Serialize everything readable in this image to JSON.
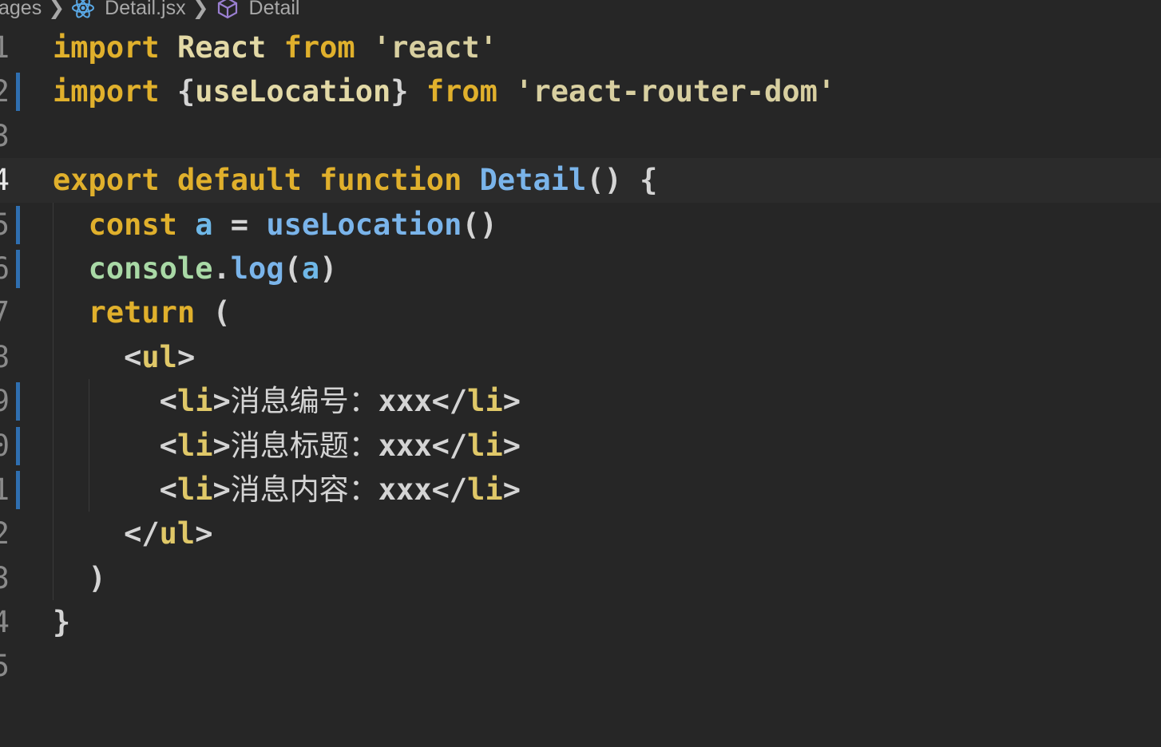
{
  "breadcrumb": {
    "items": [
      "ages",
      "Detail.jsx",
      "Detail"
    ],
    "icons": [
      "react-icon",
      "component-icon"
    ],
    "colors": {
      "react_icon": "#5aa9e6",
      "component_icon": "#9a7fd1"
    }
  },
  "editor": {
    "current_line": "4",
    "lines": [
      {
        "num": "1",
        "tokens": [
          {
            "t": "import",
            "c": "kw"
          },
          {
            "t": " ",
            "c": "pn"
          },
          {
            "t": "React",
            "c": "id"
          },
          {
            "t": " ",
            "c": "pn"
          },
          {
            "t": "from",
            "c": "kw"
          },
          {
            "t": " ",
            "c": "pn"
          },
          {
            "t": "'react'",
            "c": "str"
          }
        ]
      },
      {
        "num": "2",
        "tokens": [
          {
            "t": "import",
            "c": "kw"
          },
          {
            "t": " {",
            "c": "pn"
          },
          {
            "t": "useLocation",
            "c": "id"
          },
          {
            "t": "} ",
            "c": "pn"
          },
          {
            "t": "from",
            "c": "kw"
          },
          {
            "t": " ",
            "c": "pn"
          },
          {
            "t": "'react-router-dom'",
            "c": "str"
          }
        ]
      },
      {
        "num": "3",
        "tokens": []
      },
      {
        "num": "4",
        "tokens": [
          {
            "t": "export",
            "c": "kw"
          },
          {
            "t": " ",
            "c": "pn"
          },
          {
            "t": "default",
            "c": "kw"
          },
          {
            "t": " ",
            "c": "pn"
          },
          {
            "t": "function",
            "c": "kw"
          },
          {
            "t": " ",
            "c": "pn"
          },
          {
            "t": "Detail",
            "c": "fn"
          },
          {
            "t": "() {",
            "c": "pn"
          }
        ]
      },
      {
        "num": "5",
        "tokens": [
          {
            "t": "  ",
            "c": "pn"
          },
          {
            "t": "const",
            "c": "kw"
          },
          {
            "t": " ",
            "c": "pn"
          },
          {
            "t": "a",
            "c": "var"
          },
          {
            "t": " = ",
            "c": "pn"
          },
          {
            "t": "useLocation",
            "c": "fn"
          },
          {
            "t": "()",
            "c": "pn"
          }
        ]
      },
      {
        "num": "6",
        "tokens": [
          {
            "t": "  ",
            "c": "pn"
          },
          {
            "t": "console",
            "c": "obj"
          },
          {
            "t": ".",
            "c": "pn"
          },
          {
            "t": "log",
            "c": "fn"
          },
          {
            "t": "(",
            "c": "pn"
          },
          {
            "t": "a",
            "c": "var"
          },
          {
            "t": ")",
            "c": "pn"
          }
        ]
      },
      {
        "num": "7",
        "tokens": [
          {
            "t": "  ",
            "c": "pn"
          },
          {
            "t": "return",
            "c": "kw"
          },
          {
            "t": " (",
            "c": "pn"
          }
        ]
      },
      {
        "num": "8",
        "tokens": [
          {
            "t": "    <",
            "c": "tag"
          },
          {
            "t": "ul",
            "c": "tagn"
          },
          {
            "t": ">",
            "c": "tag"
          }
        ]
      },
      {
        "num": "9",
        "tokens": [
          {
            "t": "      <",
            "c": "tag"
          },
          {
            "t": "li",
            "c": "tagn"
          },
          {
            "t": ">",
            "c": "tag"
          },
          {
            "t": "消息编号：",
            "c": "cjk"
          },
          {
            "t": "xxx</",
            "c": "tag"
          },
          {
            "t": "li",
            "c": "tagn"
          },
          {
            "t": ">",
            "c": "tag"
          }
        ]
      },
      {
        "num": "0",
        "tokens": [
          {
            "t": "      <",
            "c": "tag"
          },
          {
            "t": "li",
            "c": "tagn"
          },
          {
            "t": ">",
            "c": "tag"
          },
          {
            "t": "消息标题：",
            "c": "cjk"
          },
          {
            "t": "xxx</",
            "c": "tag"
          },
          {
            "t": "li",
            "c": "tagn"
          },
          {
            "t": ">",
            "c": "tag"
          }
        ]
      },
      {
        "num": "1",
        "tokens": [
          {
            "t": "      <",
            "c": "tag"
          },
          {
            "t": "li",
            "c": "tagn"
          },
          {
            "t": ">",
            "c": "tag"
          },
          {
            "t": "消息内容：",
            "c": "cjk"
          },
          {
            "t": "xxx</",
            "c": "tag"
          },
          {
            "t": "li",
            "c": "tagn"
          },
          {
            "t": ">",
            "c": "tag"
          }
        ]
      },
      {
        "num": "2",
        "tokens": [
          {
            "t": "    </",
            "c": "tag"
          },
          {
            "t": "ul",
            "c": "tagn"
          },
          {
            "t": ">",
            "c": "tag"
          }
        ]
      },
      {
        "num": "3",
        "tokens": [
          {
            "t": "  )",
            "c": "pn"
          }
        ]
      },
      {
        "num": "4",
        "tokens": [
          {
            "t": "}",
            "c": "pn"
          }
        ]
      },
      {
        "num": "5",
        "tokens": []
      }
    ]
  }
}
